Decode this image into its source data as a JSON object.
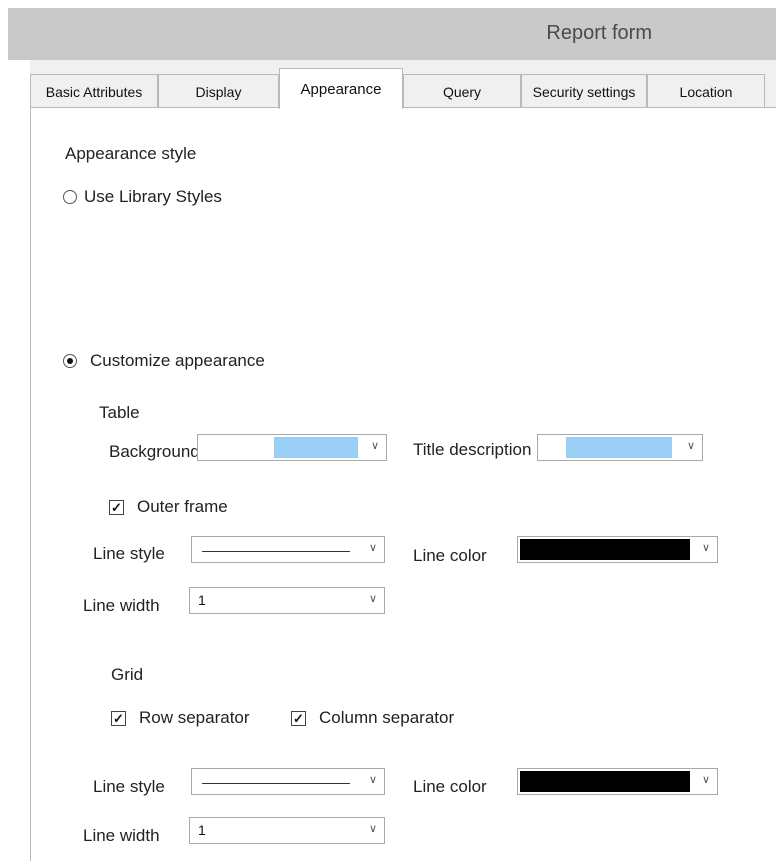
{
  "window": {
    "title": "Report form"
  },
  "tabs": [
    {
      "label": "Basic Attributes"
    },
    {
      "label": "Display"
    },
    {
      "label": "Appearance",
      "active": true
    },
    {
      "label": "Query"
    },
    {
      "label": "Security settings"
    },
    {
      "label": "Location"
    }
  ],
  "appearance": {
    "section_title": "Appearance style",
    "options": {
      "library": "Use Library Styles",
      "customize": "Customize appearance",
      "selected": "customize"
    },
    "table": {
      "title": "Table",
      "background_color": {
        "label": "Background color",
        "value": "#9acff5"
      },
      "title_description": {
        "label": "Title description",
        "value": "#9acff5"
      },
      "outer_frame": {
        "label": "Outer frame",
        "checked": true
      },
      "line_style": {
        "label": "Line style"
      },
      "line_color": {
        "label": "Line color",
        "value": "#000000"
      },
      "line_width": {
        "label": "Line width",
        "value": "1"
      }
    },
    "grid": {
      "title": "Grid",
      "row_separator": {
        "label": "Row separator",
        "checked": true
      },
      "column_separator": {
        "label": "Column separator",
        "checked": true
      },
      "line_style": {
        "label": "Line style"
      },
      "line_color": {
        "label": "Line color",
        "value": "#000000"
      },
      "line_width": {
        "label": "Line width",
        "value": "1"
      }
    }
  },
  "icons": {
    "dropdown": "chevron-down-icon",
    "check": "check-icon"
  }
}
